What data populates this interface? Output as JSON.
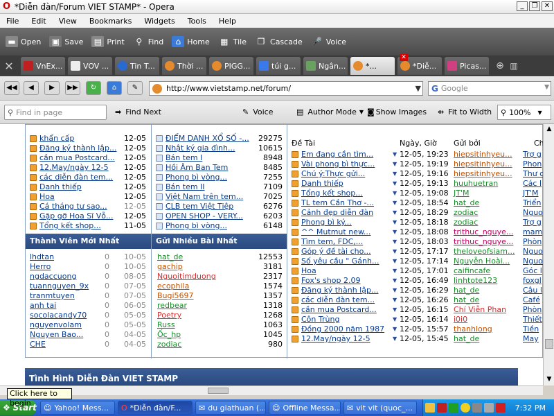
{
  "window": {
    "title": "*Diễn đàn/Forum VIET STAMP* - Opera"
  },
  "menu": [
    "File",
    "Edit",
    "View",
    "Bookmarks",
    "Widgets",
    "Tools",
    "Help"
  ],
  "toolbar": [
    "Open",
    "Save",
    "Print",
    "Find",
    "Home",
    "Tile",
    "Cascade",
    "Voice"
  ],
  "tabs": [
    "VnEx...",
    "VOV ...",
    "Tin T...",
    "Thời ...",
    "PIGG...",
    "túi g...",
    "Ngân...",
    "*...",
    "*Diễ...",
    "Picas..."
  ],
  "address": {
    "url": "http://www.vietstamp.net/forum/",
    "search_placeholder": "Google"
  },
  "findbar": {
    "find_placeholder": "Find in page",
    "find_next": "Find Next",
    "voice": "Voice",
    "author_mode": "Author Mode",
    "show_images": "Show Images",
    "fit_width": "Fit to Width",
    "zoom": "100%"
  },
  "col1": {
    "topics": [
      {
        "t": "khẩn cấp",
        "d": "12-05"
      },
      {
        "t": "Đăng ký thành lập...",
        "d": "12-05"
      },
      {
        "t": "cần mua Postcard...",
        "d": "12-05"
      },
      {
        "t": "12.May/ngày 12-5",
        "d": "12-05"
      },
      {
        "t": "các diễn đàn tem...",
        "d": "12-05"
      },
      {
        "t": "Danh thiếp",
        "d": "12-05"
      },
      {
        "t": "Hoa",
        "d": "12-05"
      },
      {
        "t": "Cá tháng tư sao...",
        "d": "12-05"
      },
      {
        "t": "Gặp gỡ Hoa Sĩ Vỗ...",
        "d": "12-05"
      },
      {
        "t": "Tổng kết shop...",
        "d": "11-05"
      }
    ],
    "members_header": "Thành Viên Mới Nhất",
    "members": [
      {
        "n": "lhdtan",
        "c": "0",
        "d": "10-05"
      },
      {
        "n": "Herro",
        "c": "0",
        "d": "10-05"
      },
      {
        "n": "ngdaccuong",
        "c": "0",
        "d": "08-05"
      },
      {
        "n": "tuannguyen_9x",
        "c": "0",
        "d": "07-05"
      },
      {
        "n": "tranmtuyen",
        "c": "0",
        "d": "07-05"
      },
      {
        "n": "anh tai",
        "c": "0",
        "d": "06-05"
      },
      {
        "n": "socolacandy70",
        "c": "0",
        "d": "05-05"
      },
      {
        "n": "nguyenvolam",
        "c": "0",
        "d": "05-05"
      },
      {
        "n": "Nguyen Bao...",
        "c": "0",
        "d": "04-05"
      },
      {
        "n": "CHE",
        "c": "0",
        "d": "04-05"
      }
    ]
  },
  "col2": {
    "topics": [
      {
        "t": "ĐIỂM DANH XỔ SỐ -...",
        "n": "29275"
      },
      {
        "t": "Nhật ký gia đình...",
        "n": "10615"
      },
      {
        "t": "Bán tem I",
        "n": "8948"
      },
      {
        "t": "Hồi Âm Ban Tem",
        "n": "8485"
      },
      {
        "t": "Phong bì vòng...",
        "n": "7255"
      },
      {
        "t": "Bán tem II",
        "n": "7109"
      },
      {
        "t": "Việt Nam trên tem...",
        "n": "7025"
      },
      {
        "t": "CLB tem Việt Tiệp",
        "n": "6276"
      },
      {
        "t": "OPEN SHOP - VERY...",
        "n": "6203"
      },
      {
        "t": "Phong bì vòng...",
        "n": "6148"
      }
    ],
    "posters_header": "Gửi Nhiều Bài Nhất",
    "posters": [
      {
        "n": "hat_de",
        "c": "12553",
        "k": "u1"
      },
      {
        "n": "gachip",
        "c": "3181",
        "k": "u2"
      },
      {
        "n": "Nguoitimduong",
        "c": "2317",
        "k": "u4"
      },
      {
        "n": "ecophila",
        "c": "1574",
        "k": "u2"
      },
      {
        "n": "Bugi5697",
        "c": "1357",
        "k": "u2"
      },
      {
        "n": "redbear",
        "c": "1318",
        "k": "u1"
      },
      {
        "n": "Poetry",
        "c": "1268",
        "k": "u4"
      },
      {
        "n": "Russ",
        "c": "1063",
        "k": "u1"
      },
      {
        "n": "Ốc_hp",
        "c": "1045",
        "k": "u1"
      },
      {
        "n": "zodiac",
        "c": "980",
        "k": "u1"
      }
    ]
  },
  "col3": {
    "headers": [
      "Đề Tài",
      "Ngày, Giờ",
      "Gửi bởi",
      "Ch"
    ],
    "rows": [
      {
        "t": "Em đang cần tìm...",
        "d": "12-05, 19:23",
        "u": "hiepsitinhyeu...",
        "k": "u2",
        "x": "Trợ g"
      },
      {
        "t": "Vài phong bì thực...",
        "d": "12-05, 19:19",
        "u": "hiepsitinhyeu...",
        "k": "u2",
        "x": "Phon"
      },
      {
        "t": "Chú ý:Thực gửi...",
        "d": "12-05, 19:16",
        "u": "hiepsitinhyeu...",
        "k": "u2",
        "x": "Thư c"
      },
      {
        "t": "Danh thiếp",
        "d": "12-05, 19:13",
        "u": "huuhuetran",
        "k": "u1",
        "x": "Các l"
      },
      {
        "t": "Tổng kết shop...",
        "d": "12-05, 19:08",
        "u": "JT'M",
        "k": "u1",
        "x": "JT'M"
      },
      {
        "t": "TL tem Cần Thơ -...",
        "d": "12-05, 18:54",
        "u": "hat_de",
        "k": "u1",
        "x": "Triển"
      },
      {
        "t": "Cảnh đẹp diễn đàn",
        "d": "12-05, 18:29",
        "u": "zodiac",
        "k": "u1",
        "x": "Nguo"
      },
      {
        "t": "Phong bì ký...",
        "d": "12-05, 18:18",
        "u": "zodiac",
        "k": "u1",
        "x": "Trợ g"
      },
      {
        "t": "^^ Mutmut new...",
        "d": "12-05, 18:08",
        "u": "trithuc_nguye...",
        "k": "u3",
        "x": "mam"
      },
      {
        "t": "Tìm tem, FDC,...",
        "d": "12-05, 18:03",
        "u": "trithuc_nguye...",
        "k": "u3",
        "x": "Phòn"
      },
      {
        "t": "Góp ý đề tài cho...",
        "d": "12-05, 17:17",
        "u": "theloveofsiam...",
        "k": "u1",
        "x": "Nguo"
      },
      {
        "t": "Số yêu cầu \" Gánh...",
        "d": "12-05, 17:14",
        "u": "Nguyễn Hoài...",
        "k": "u1",
        "x": "Nguo"
      },
      {
        "t": "Hoa",
        "d": "12-05, 17:01",
        "u": "caifincafe",
        "k": "u1",
        "x": "Góc l"
      },
      {
        "t": "Fox's shop 2.09",
        "d": "12-05, 16:49",
        "u": "linhtote123",
        "k": "u1",
        "x": "foxgl"
      },
      {
        "t": "Đăng ký thành lập...",
        "d": "12-05, 16:29",
        "u": "hat_de",
        "k": "u1",
        "x": "Câu l"
      },
      {
        "t": "các diễn đàn tem...",
        "d": "12-05, 16:26",
        "u": "hat_de",
        "k": "u1",
        "x": "Café"
      },
      {
        "t": "cần mua Postcard...",
        "d": "12-05, 16:15",
        "u": "Chí Viễn Phan",
        "k": "u4",
        "x": "Phòn"
      },
      {
        "t": "Côn Trùng",
        "d": "12-05, 16:14",
        "u": "i0i0",
        "k": "u4",
        "x": "Thiết"
      },
      {
        "t": "Đồng 2000 năm 1987",
        "d": "12-05, 15:57",
        "u": "thanhlong",
        "k": "u2",
        "x": "Tiền"
      },
      {
        "t": "12.May/ngày 12-5",
        "d": "12-05, 15:45",
        "u": "hat_de",
        "k": "u1",
        "x": "May"
      }
    ]
  },
  "footer_title": "Tình Hình Diễn Đàn VIET STAMP",
  "tooltip": "Click here to begin",
  "taskbar": {
    "start": "Start",
    "items": [
      "Yahoo! Mess...",
      "*Diễn đàn/F...",
      "du giathuan (...",
      "Offline Messa...",
      "vit vit (quoc_..."
    ],
    "clock": "7:32 PM"
  }
}
